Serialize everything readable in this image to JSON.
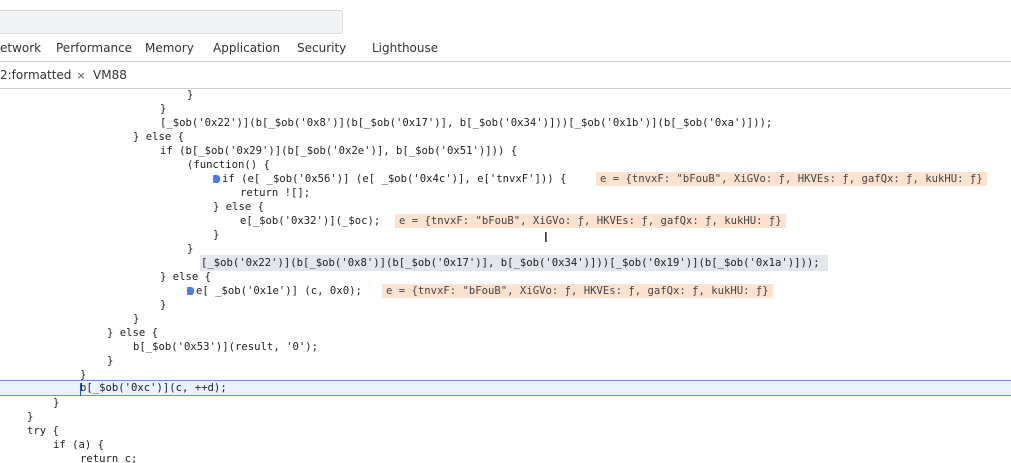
{
  "panel_tabs": [
    "etwork",
    "Performance",
    "Memory",
    "Application",
    "Security",
    "Lighthouse"
  ],
  "file_tabs": {
    "active": "2:formatted",
    "close_symbol": "×",
    "second": "VM88"
  },
  "code_lines": [
    "}",
    "}",
    "[_$ob('0x22')](b[_$ob('0x8')](b[_$ob('0x17')], b[_$ob('0x34')]))[_$ob('0x1b')](b[_$ob('0xa')]));",
    "} else {",
    "if (b[_$ob('0x29')](b[_$ob('0x2e')], b[_$ob('0x51')])) {",
    "(function() {",
    "if (e[ _$ob('0x56')] (e[ _$ob('0x4c')], e['tnvxF'])) {",
    "return ![];",
    "} else {",
    "e[_$ob('0x32')](_$oc);",
    "}",
    "}",
    "[_$ob('0x22')](b[_$ob('0x8')](b[_$ob('0x17')], b[_$ob('0x34')]))[_$ob('0x19')](b[_$ob('0x1a')]));",
    "} else {",
    "e[ _$ob('0x1e')] (c, 0x0);",
    "}",
    "}",
    "} else {",
    "b[_$ob('0x53')](result, '0');",
    "}",
    "}",
    "b[_$ob('0xc')](c, ++d);",
    "}",
    "}",
    "try {",
    "if (a) {",
    "return c;"
  ],
  "inline_values": {
    "line_6": "e = {tnvxF: \"bFouB\", XiGVo: ƒ, HKVEs: ƒ, gafQx: ƒ, kukHU: ƒ}",
    "line_9": "e = {tnvxF: \"bFouB\", XiGVo: ƒ, HKVEs: ƒ, gafQx: ƒ, kukHU: ƒ}",
    "line_14": "e = {tnvxF: \"bFouB\", XiGVo: ƒ, HKVEs: ƒ, gafQx: ƒ, kukHU: ƒ}"
  },
  "colors": {
    "string": "#b42a2a",
    "inline_value_bg": "#fde3cf",
    "current_line_bg": "#eaf1ff",
    "breakpoint": "#4e7bef"
  }
}
